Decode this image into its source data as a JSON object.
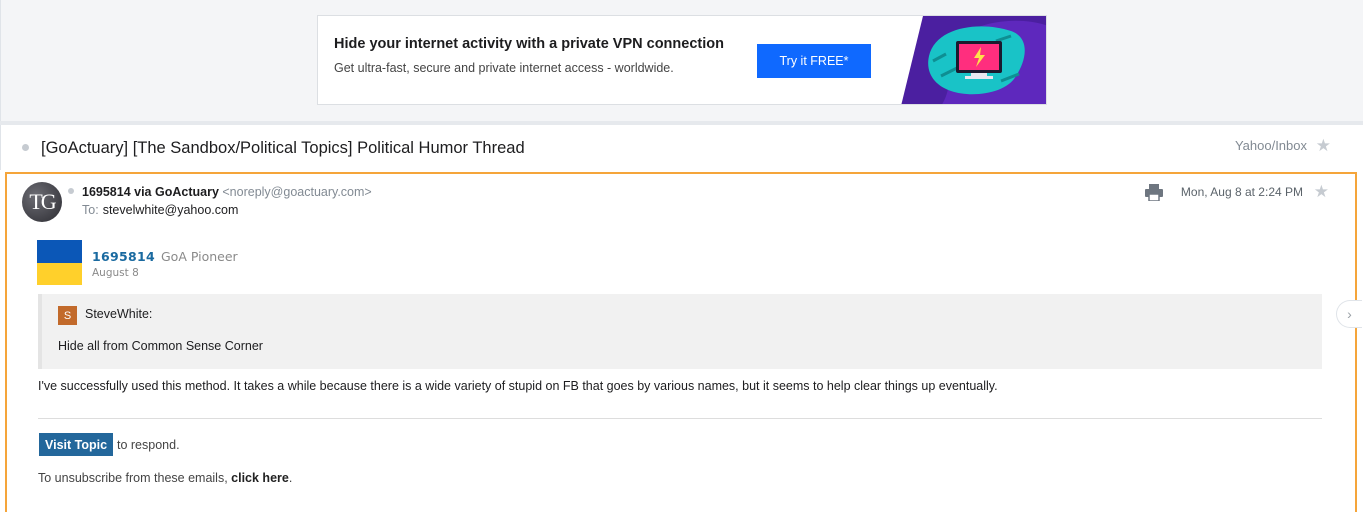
{
  "ad": {
    "headline": "Hide your internet activity with a private VPN connection",
    "subtext": "Get ultra-fast, secure and private internet access - worldwide.",
    "cta": "Try it FREE*"
  },
  "thread": {
    "subject": "[GoActuary] [The Sandbox/Political Topics] Political Humor Thread",
    "folder": "Yahoo/Inbox",
    "star_icon": "star-icon"
  },
  "message": {
    "avatar_initials": "TG",
    "sender_name": "1695814 via GoActuary",
    "sender_address": "<noreply@goactuary.com>",
    "to_label": "To:",
    "to_address": "stevelwhite@yahoo.com",
    "date": "Mon, Aug 8 at 2:24 PM",
    "print_icon": "printer-icon"
  },
  "post": {
    "username": "1695814",
    "rank": "GoA Pioneer",
    "date": "August 8",
    "quote_avatar_letter": "S",
    "quote_author": "SteveWhite:",
    "quote_text": "Hide all from Common Sense Corner",
    "body": "I've successfully used this method. It takes a while because there is a wide variety of stupid on FB that goes by various names, but it seems to help clear things up eventually.",
    "visit_label": "Visit Topic",
    "respond_text": "to respond.",
    "unsubscribe_prefix": "To unsubscribe from these emails,",
    "unsubscribe_link": "click here",
    "unsubscribe_suffix": "."
  },
  "colors": {
    "accent_button": "#0f69ff",
    "selected_border": "#f5a53a",
    "visit_button": "#23679b"
  }
}
